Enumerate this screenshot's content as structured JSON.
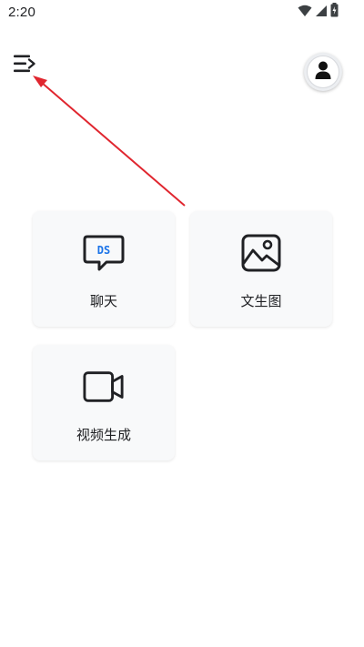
{
  "status_bar": {
    "time": "2:20",
    "icons": [
      "wifi-icon",
      "signal-icon",
      "battery-icon"
    ]
  },
  "header": {
    "menu_icon": "menu-expand-icon",
    "avatar_icon": "user-icon"
  },
  "features": [
    {
      "label": "聊天",
      "icon": "chat-ds-icon",
      "icon_accent": "#1a73e8"
    },
    {
      "label": "文生图",
      "icon": "image-icon"
    },
    {
      "label": "视频生成",
      "icon": "video-camera-icon"
    }
  ],
  "annotation": {
    "arrow_color": "#e0262f"
  }
}
